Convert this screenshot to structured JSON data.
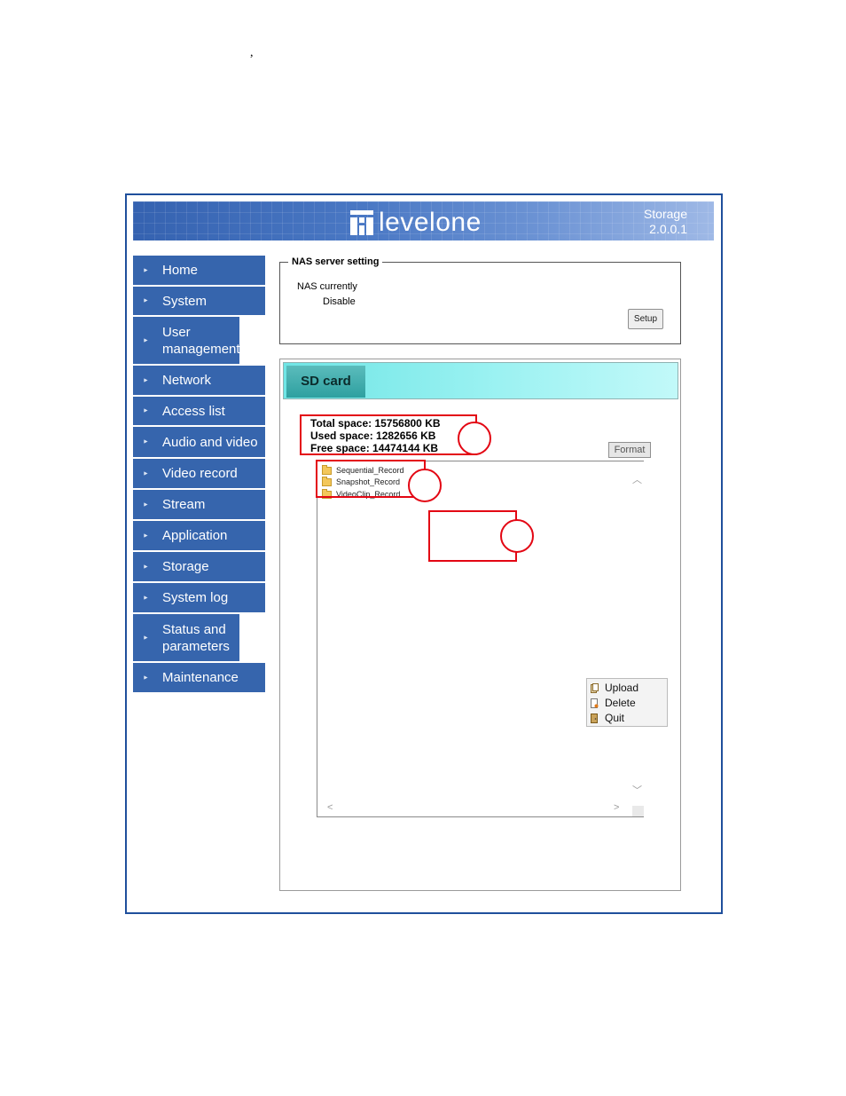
{
  "stray_mark": ",",
  "banner": {
    "logo_text": "levelone",
    "title_line1": "Storage",
    "title_line2": "2.0.0.1"
  },
  "sidebar": {
    "items": [
      {
        "label": "Home"
      },
      {
        "label": "System"
      },
      {
        "label": "User management"
      },
      {
        "label": "Network"
      },
      {
        "label": "Access list"
      },
      {
        "label": "Audio and video"
      },
      {
        "label": "Video record"
      },
      {
        "label": "Stream"
      },
      {
        "label": "Application"
      },
      {
        "label": "Storage"
      },
      {
        "label": "System log"
      },
      {
        "label": "Status and parameters"
      },
      {
        "label": "Maintenance"
      }
    ]
  },
  "nas": {
    "legend": "NAS server setting",
    "label": "NAS currently",
    "value": "Disable",
    "setup_label": "Setup"
  },
  "sd": {
    "tab_label": "SD card",
    "total": "Total space: 15756800 KB",
    "used": "Used space: 1282656 KB",
    "free": "Free space: 14474144 KB",
    "format_label": "Format",
    "folders": [
      "Sequential_Record",
      "Snapshot_Record",
      "VideoClip_Record"
    ],
    "menu": {
      "upload": "Upload",
      "delete": "Delete",
      "quit": "Quit"
    }
  },
  "colors": {
    "sidebar": "#3665ad",
    "annotation": "#e30613",
    "sd_header": "#98f1f1",
    "frame_border": "#1f4f9c"
  }
}
